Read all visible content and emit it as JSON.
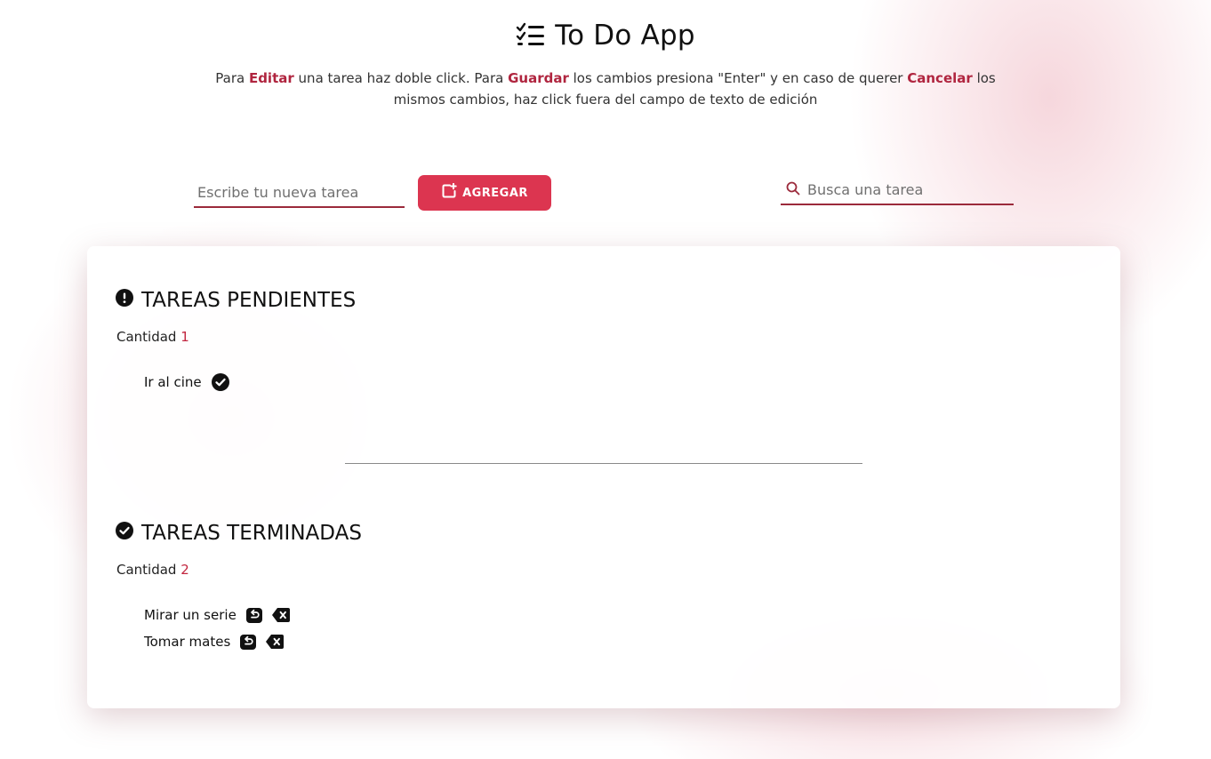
{
  "header": {
    "title": "To Do App",
    "instructions": {
      "p1": "Para ",
      "edit": "Editar",
      "p2": " una tarea haz doble click. Para ",
      "save": "Guardar",
      "p3": " los cambios presiona \"Enter\" y en caso de querer ",
      "cancel": "Cancelar",
      "p4": " los mismos cambios, haz click fuera del campo de texto de edición"
    }
  },
  "controls": {
    "new_task_placeholder": "Escribe tu nueva tarea",
    "new_task_value": "",
    "add_label": "AGREGAR",
    "search_placeholder": "Busca una tarea",
    "search_value": ""
  },
  "pending": {
    "title": "TAREAS PENDIENTES",
    "count_label": "Cantidad",
    "count": "1",
    "tasks": [
      {
        "label": "Ir al cine"
      }
    ]
  },
  "done": {
    "title": "TAREAS TERMINADAS",
    "count_label": "Cantidad",
    "count": "2",
    "tasks": [
      {
        "label": "Mirar un serie"
      },
      {
        "label": "Tomar mates"
      }
    ]
  },
  "icons": {
    "title": "checklist-icon",
    "add": "add-note-icon",
    "search": "search-icon",
    "pending": "exclamation-circle-icon",
    "done": "check-circle-icon",
    "complete": "check-circle-icon",
    "restore": "undo-icon",
    "delete": "backspace-delete-icon"
  },
  "colors": {
    "accent": "#dc3550",
    "highlight_text": "#b0253f",
    "underline": "#9b2a3b",
    "count_number": "#c2263f"
  }
}
